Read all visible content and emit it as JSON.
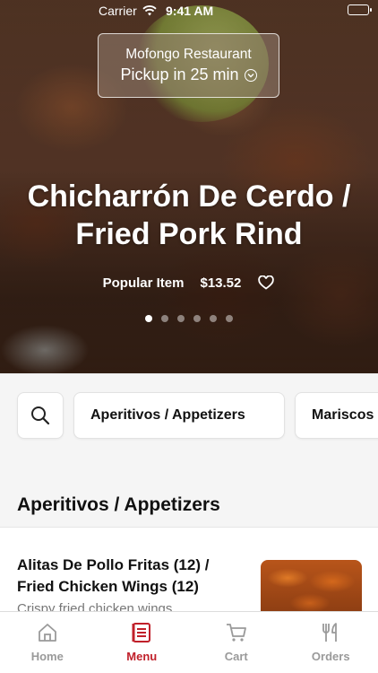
{
  "status_bar": {
    "carrier": "Carrier",
    "time": "9:41 AM"
  },
  "restaurant": {
    "name": "Mofongo Restaurant",
    "pickup": "Pickup in 25 min"
  },
  "hero": {
    "title": "Chicharrón De Cerdo / Fried Pork Rind",
    "tag": "Popular Item",
    "price": "$13.52",
    "slides_total": 6,
    "active_slide": 1
  },
  "categories": {
    "search_icon": "search-icon",
    "chips": [
      "Aperitivos / Appetizers",
      "Mariscos"
    ]
  },
  "section": {
    "title": "Aperitivos / Appetizers",
    "items": [
      {
        "name": "Alitas De Pollo Fritas (12) / Fried Chicken Wings (12)",
        "description": "Crispy fried chicken wings"
      }
    ]
  },
  "tabs": [
    {
      "label": "Home",
      "icon": "home-icon",
      "active": false
    },
    {
      "label": "Menu",
      "icon": "menu-icon",
      "active": true
    },
    {
      "label": "Cart",
      "icon": "cart-icon",
      "active": false
    },
    {
      "label": "Orders",
      "icon": "orders-icon",
      "active": false
    }
  ],
  "colors": {
    "accent": "#c0202a",
    "inactive_tab": "#9a9a9a"
  }
}
